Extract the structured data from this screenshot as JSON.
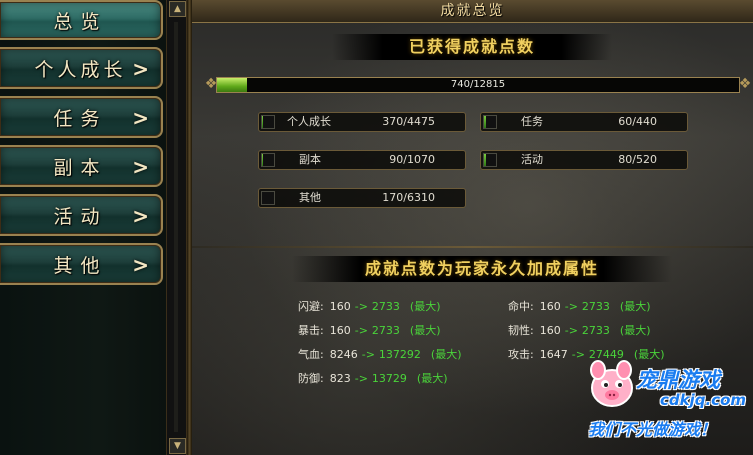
{
  "sidebar": {
    "items": [
      {
        "label": "总览",
        "active": true,
        "chevron": false
      },
      {
        "label": "个人成长",
        "active": false,
        "chevron": true
      },
      {
        "label": "任务",
        "active": false,
        "chevron": true
      },
      {
        "label": "副本",
        "active": false,
        "chevron": true
      },
      {
        "label": "活动",
        "active": false,
        "chevron": true
      },
      {
        "label": "其他",
        "active": false,
        "chevron": true
      }
    ],
    "chevron_glyph": ">"
  },
  "scrollbar": {
    "up": "▲",
    "down": "▼"
  },
  "main": {
    "title": "成就总览",
    "points_banner": "已获得成就点数",
    "total": {
      "text": "740/12815",
      "current": 740,
      "max": 12815
    },
    "categories": [
      {
        "name": "个人成长",
        "value": "370/4475",
        "current": 370,
        "max": 4475
      },
      {
        "name": "任务",
        "value": "60/440",
        "current": 60,
        "max": 440
      },
      {
        "name": "副本",
        "value": "90/1070",
        "current": 90,
        "max": 1070
      },
      {
        "name": "活动",
        "value": "80/520",
        "current": 80,
        "max": 520
      },
      {
        "name": "其他",
        "value": "170/6310",
        "current": 170,
        "max": 6310
      }
    ],
    "attr_banner": "成就点数为玩家永久加成属性",
    "attributes": [
      {
        "name": "闪避:",
        "from": "160",
        "arrow": "->",
        "to": "2733",
        "note": "(最大)"
      },
      {
        "name": "命中:",
        "from": "160",
        "arrow": "->",
        "to": "2733",
        "note": "(最大)"
      },
      {
        "name": "暴击:",
        "from": "160",
        "arrow": "->",
        "to": "2733",
        "note": "(最大)"
      },
      {
        "name": "韧性:",
        "from": "160",
        "arrow": "->",
        "to": "2733",
        "note": "(最大)"
      },
      {
        "name": "气血:",
        "from": "8246",
        "arrow": "->",
        "to": "137292",
        "note": "(最大)"
      },
      {
        "name": "攻击:",
        "from": "1647",
        "arrow": "->",
        "to": "27449",
        "note": "(最大)"
      },
      {
        "name": "防御:",
        "from": "823",
        "arrow": "->",
        "to": "13729",
        "note": "(最大)"
      }
    ]
  },
  "watermark": {
    "line1": "宠鼎游戏",
    "line2": "cdkjq.com",
    "line3": "我们不光做游戏！"
  },
  "colors": {
    "accent_gold": "#f0d060",
    "progress_green": "#4ad43a",
    "frame_gold": "#9a8250",
    "nav_teal": "#2e6b64"
  }
}
